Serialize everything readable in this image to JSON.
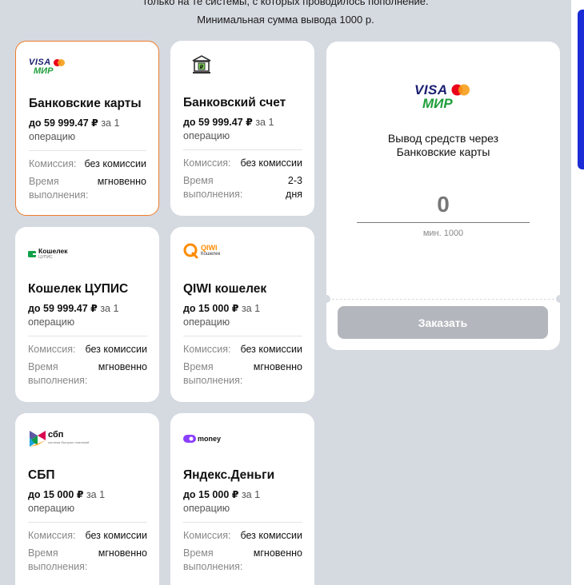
{
  "notice": {
    "line1": "только на те системы, с которых проводилось пополнение.",
    "line2": "Минимальная сумма вывода 1000 р."
  },
  "brand_text": {
    "visa": "VISA",
    "mir": "МИР",
    "koshelek": "Кошелек",
    "koshelek_sub": "ЦУПИС",
    "qiwi": "QIWI",
    "qiwi_sub": "Кошелек",
    "sbp": "сбп",
    "sbp_sub": "система быстрых платежей",
    "yoomoney": "money"
  },
  "labels": {
    "commission": "Комиссия:",
    "time": "Время выполнения:",
    "per_op": "за 1 операцию"
  },
  "methods": [
    {
      "title": "Банковские карты",
      "limit": "до 59 999.47 ₽",
      "commission": "без комиссии",
      "time": "мгновенно",
      "logo": "visa-mir-logo",
      "selected": true
    },
    {
      "title": "Банковский счет",
      "limit": "до 59 999.47 ₽",
      "commission": "без комиссии",
      "time": "2-3 дня",
      "logo": "bank-icon",
      "selected": false
    },
    {
      "title": "Кошелек ЦУПИС",
      "limit": "до 59 999.47 ₽",
      "commission": "без комиссии",
      "time": "мгновенно",
      "logo": "koshelek-logo",
      "selected": false
    },
    {
      "title": "QIWI кошелек",
      "limit": "до 15 000 ₽",
      "commission": "без комиссии",
      "time": "мгновенно",
      "logo": "qiwi-logo",
      "selected": false
    },
    {
      "title": "СБП",
      "limit": "до 15 000 ₽",
      "commission": "без комиссии",
      "time": "мгновенно",
      "logo": "sbp-logo",
      "selected": false
    },
    {
      "title": "Яндекс.Деньги",
      "limit": "до 15 000 ₽",
      "commission": "без комиссии",
      "time": "мгновенно",
      "logo": "yoomoney-logo",
      "selected": false
    }
  ],
  "panel": {
    "title": "Вывод средств через Банковские карты",
    "amount_value": "0",
    "min_hint": "мин. 1000",
    "submit_label": "Заказать"
  },
  "colors": {
    "background": "#d5d9e0",
    "selected_border": "#f07c2a",
    "button_disabled": "#b3b6bd",
    "side_accent": "#1b2bd6"
  }
}
